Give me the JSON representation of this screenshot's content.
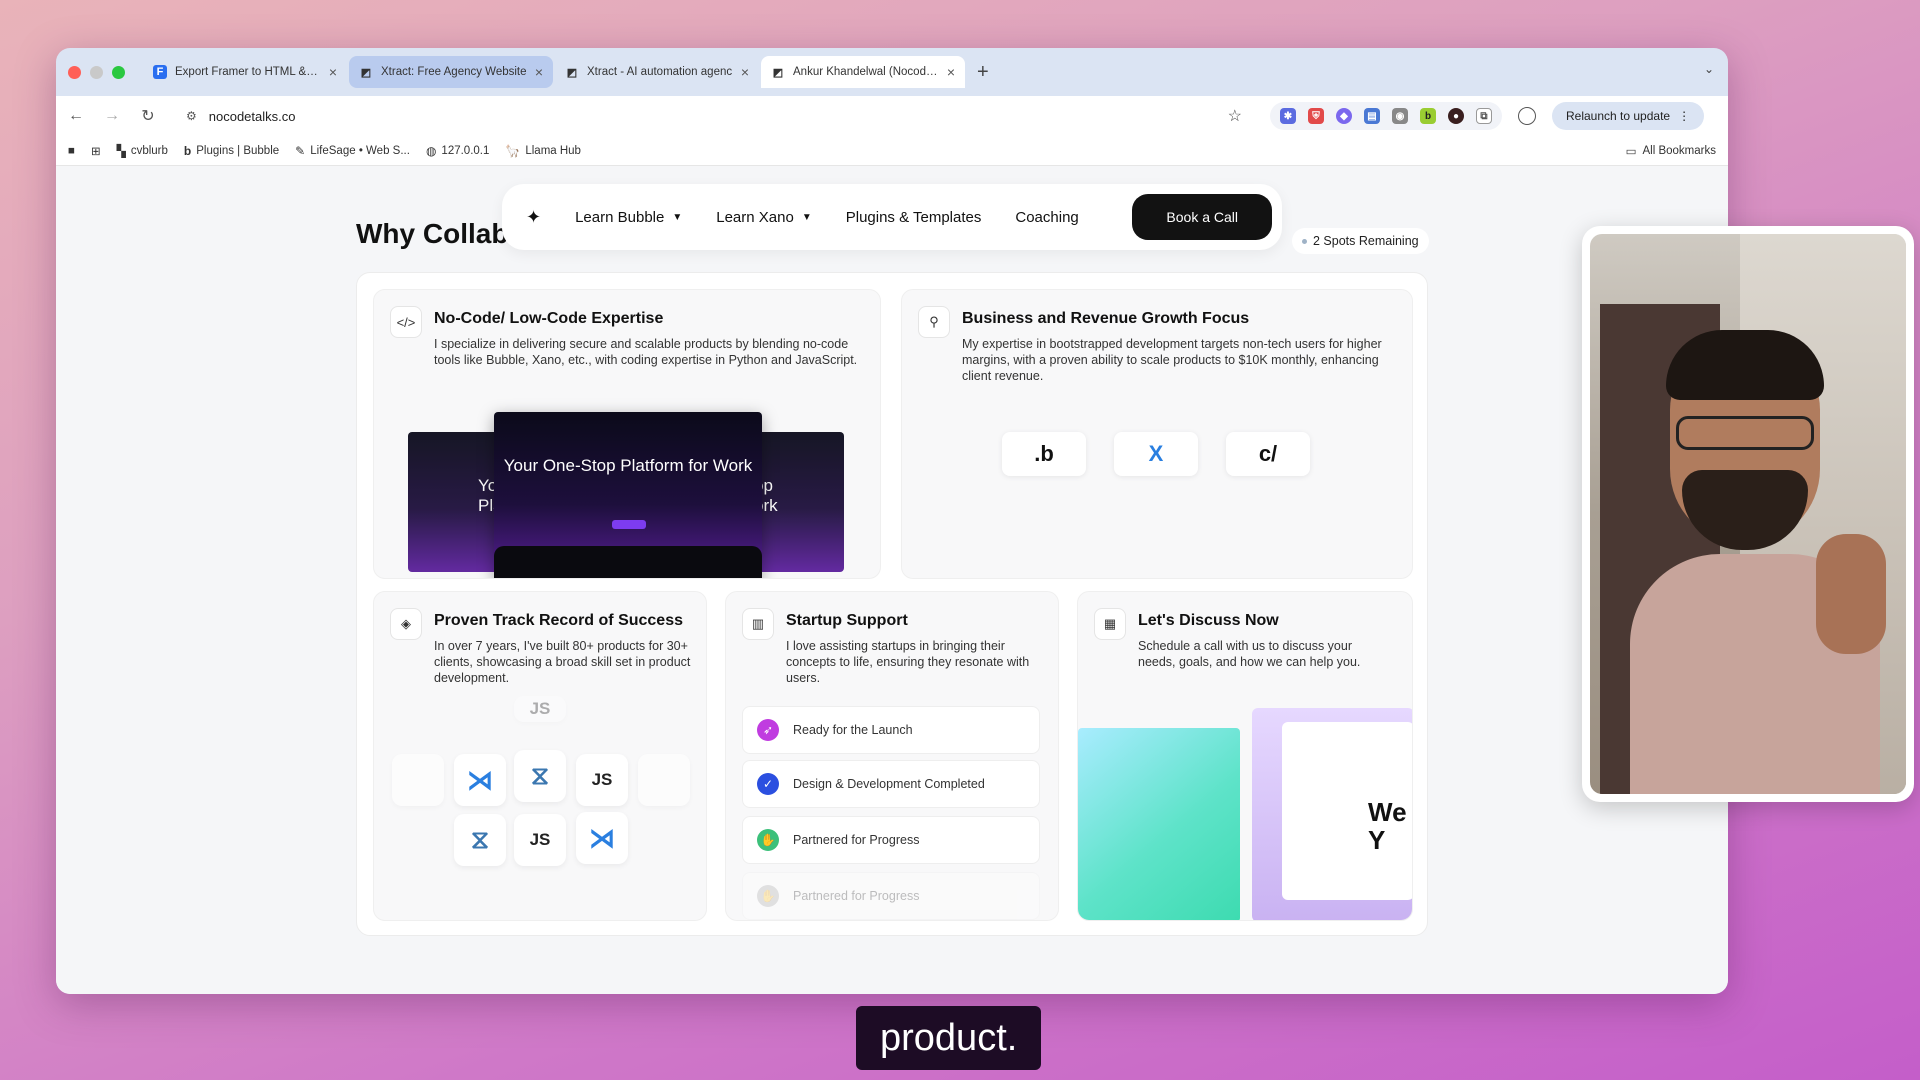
{
  "browser": {
    "tabs": [
      {
        "favicon": "framer-icon",
        "title": "Export Framer to HTML & Co"
      },
      {
        "favicon": "xtract-icon",
        "title": "Xtract: Free Agency Website"
      },
      {
        "favicon": "xtract-icon",
        "title": "Xtract - AI automation agenc"
      },
      {
        "favicon": "xtract-icon",
        "title": "Ankur Khandelwal (Nocodeta"
      }
    ],
    "url": "nocodetalks.co",
    "relaunch_label": "Relaunch to update",
    "bookmarks": [
      {
        "label": "cvblurb"
      },
      {
        "label": "Plugins | Bubble"
      },
      {
        "label": "LifeSage • Web S..."
      },
      {
        "label": "127.0.0.1"
      },
      {
        "label": "Llama Hub"
      }
    ],
    "all_bookmarks": "All Bookmarks"
  },
  "site": {
    "nav": {
      "items": [
        "Learn Bubble",
        "Learn Xano",
        "Plugins & Templates",
        "Coaching"
      ],
      "cta": "Book a Call"
    },
    "section_title": "Why Collaborate with Me?",
    "spots_badge": "2 Spots Remaining",
    "cards": {
      "nocode": {
        "title": "No-Code/ Low-Code Expertise",
        "desc": "I specialize in delivering secure and scalable products by blending no-code tools like Bubble, Xano, etc., with coding expertise in Python and JavaScript.",
        "mock_title": "Your One-Stop Platform for Work"
      },
      "growth": {
        "title": "Business and Revenue Growth Focus",
        "desc": "My expertise in bootstrapped development targets non-tech users for higher margins, with a proven ability to scale products to $10K monthly, enhancing client revenue.",
        "logos": [
          ".b",
          "X",
          "c/"
        ]
      },
      "track": {
        "title": "Proven Track Record of Success",
        "desc": "In over 7 years, I've built 80+ products for 30+ clients, showcasing a broad skill set in product development.",
        "tech": [
          "JS",
          "JS",
          "JS"
        ]
      },
      "startup": {
        "title": "Startup Support",
        "desc": "I love assisting startups in bringing their concepts to life, ensuring they resonate with users.",
        "statuses": [
          "Ready for the Launch",
          "Design & Development Completed",
          "Partnered for Progress",
          "Partnered for Progress"
        ]
      },
      "discuss": {
        "title": "Let's Discuss Now",
        "desc": "Schedule a call with us to discuss your needs, goals, and how we can help you.",
        "preview_text": "We Y"
      }
    }
  },
  "caption": "product.",
  "colors": {
    "background_gradient": [
      "#e9b3b9",
      "#c45ec9"
    ],
    "cta": "#121212",
    "close_red": "#ff5f57",
    "maximize_green": "#2ac840"
  }
}
